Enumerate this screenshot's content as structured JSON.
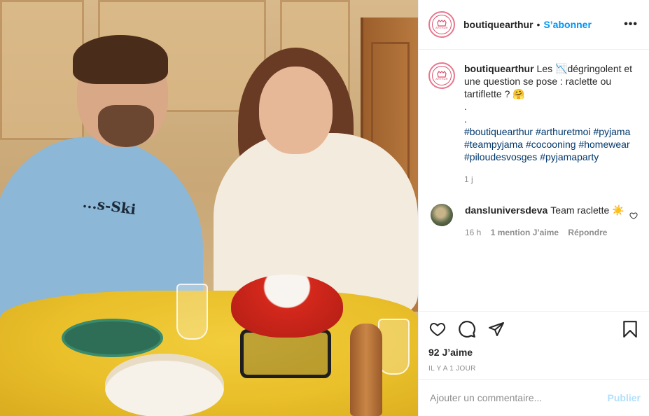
{
  "post": {
    "username": "boutiquearthur",
    "follow_label": "S’abonner",
    "separator": "•",
    "more_label": "•••",
    "avatar_brand": "ARTHUR",
    "caption": {
      "username": "boutiquearthur",
      "line1": "Les 📉dégringolent et une question se pose : raclette ou tartiflette ? 🤗",
      "dot1": ".",
      "dot2": ".",
      "hashtags": [
        "#boutiquearthur",
        "#arthuretmoi",
        "#pyjama",
        "#teampyjama",
        "#cocooning",
        "#homewear",
        "#piloudesvosges",
        "#pyjamaparty"
      ],
      "time": "1 j"
    },
    "comments": [
      {
        "username": "dansluniversdeva",
        "text": "Team raclette ☀️",
        "time": "16 h",
        "likes": "1 mention J’aime",
        "reply": "Répondre"
      }
    ],
    "likes": "92 J’aime",
    "date": "IL Y A 1 JOUR",
    "add_comment_placeholder": "Ajouter un commentaire...",
    "publish_label": "Publier"
  },
  "photo": {
    "shirt_print": "...s-Ski"
  },
  "colors": {
    "link_blue": "#0095f6",
    "hashtag": "#00376b",
    "muted": "#8e8e8e",
    "publish_disabled": "#b2dffc",
    "avatar_ring": "#e8778d"
  },
  "icons": [
    "heart-icon",
    "comment-icon",
    "share-icon",
    "bookmark-icon",
    "more-icon"
  ]
}
